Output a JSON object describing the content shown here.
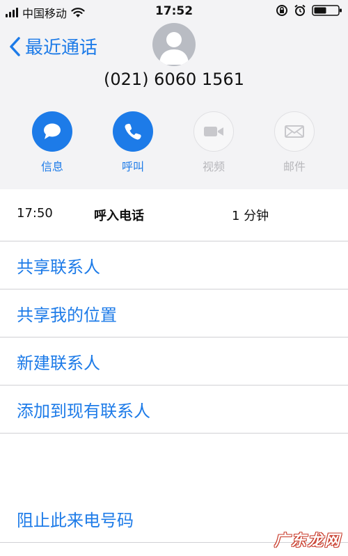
{
  "status_bar": {
    "carrier": "中国移动",
    "time": "17:52"
  },
  "nav": {
    "back_label": "最近通话"
  },
  "contact": {
    "number": "(021) 6060 1561"
  },
  "actions": [
    {
      "label": "信息",
      "icon": "message-icon",
      "enabled": true
    },
    {
      "label": "呼叫",
      "icon": "phone-icon",
      "enabled": true
    },
    {
      "label": "视频",
      "icon": "video-icon",
      "enabled": false
    },
    {
      "label": "邮件",
      "icon": "mail-icon",
      "enabled": false
    }
  ],
  "call_log": {
    "time": "17:50",
    "type": "呼入电话",
    "duration": "1 分钟"
  },
  "options": [
    {
      "label": "共享联系人"
    },
    {
      "label": "共享我的位置"
    },
    {
      "label": "新建联系人"
    },
    {
      "label": "添加到现有联系人"
    }
  ],
  "block": {
    "label": "阻止此来电号码"
  },
  "watermark": "广东龙网",
  "colors": {
    "accent": "#1d7be8",
    "disabled": "#b7b7bb",
    "header_bg": "#f3f3f5"
  }
}
